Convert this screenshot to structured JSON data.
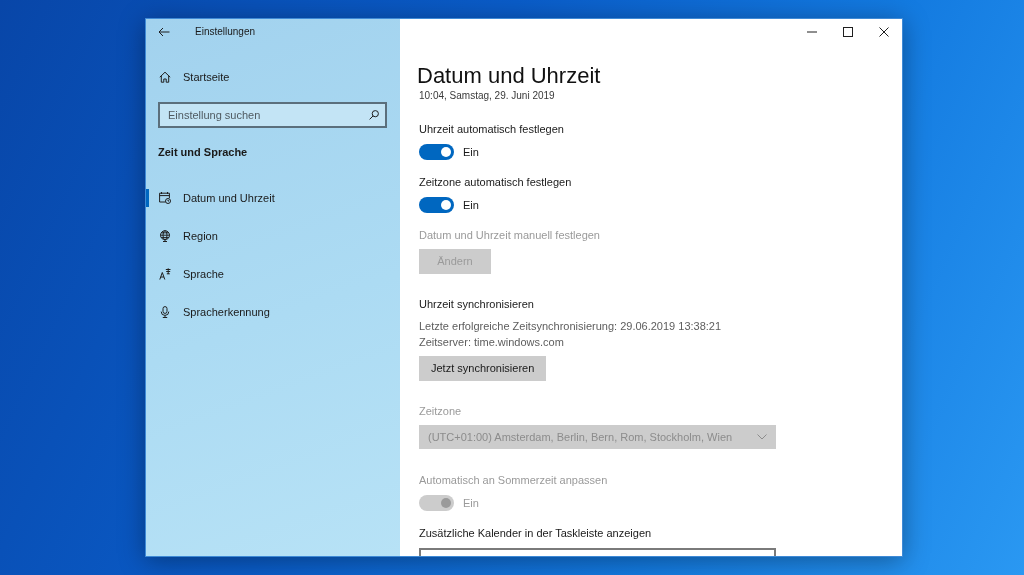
{
  "window": {
    "title": "Einstellungen"
  },
  "sidebar": {
    "home": "Startseite",
    "search": {
      "placeholder": "Einstellung suchen"
    },
    "section": "Zeit und Sprache",
    "items": [
      {
        "label": "Datum und Uhrzeit",
        "selected": true
      },
      {
        "label": "Region",
        "selected": false
      },
      {
        "label": "Sprache",
        "selected": false
      },
      {
        "label": "Spracherkennung",
        "selected": false
      }
    ]
  },
  "page": {
    "title": "Datum und Uhrzeit",
    "current_time": "10:04, Samstag, 29. Juni 2019",
    "settings": [
      {
        "kind": "toggle",
        "label": "Uhrzeit automatisch festlegen",
        "on": true,
        "state_text": "Ein",
        "disabled": false
      },
      {
        "kind": "toggle",
        "label": "Zeitzone automatisch festlegen",
        "on": true,
        "state_text": "Ein",
        "disabled": false
      },
      {
        "kind": "button",
        "label": "Datum und Uhrzeit manuell festlegen",
        "button": "Ändern",
        "disabled": true
      },
      {
        "kind": "button",
        "label": "Uhrzeit synchronisieren",
        "lines": [
          "Letzte erfolgreiche Zeitsynchronisierung: 29.06.2019 13:38:21",
          "Zeitserver: time.windows.com"
        ],
        "button": "Jetzt synchronisieren",
        "disabled": false
      },
      {
        "kind": "dropdown",
        "label": "Zeitzone",
        "value": "(UTC+01:00) Amsterdam, Berlin, Bern, Rom, Stockholm, Wien",
        "disabled": true
      },
      {
        "kind": "toggle",
        "label": "Automatisch an Sommerzeit anpassen",
        "on": true,
        "state_text": "Ein",
        "disabled": true
      },
      {
        "kind": "dropdown",
        "label": "Zusätzliche Kalender in der Taskleiste anzeigen",
        "disabled": false
      }
    ]
  }
}
